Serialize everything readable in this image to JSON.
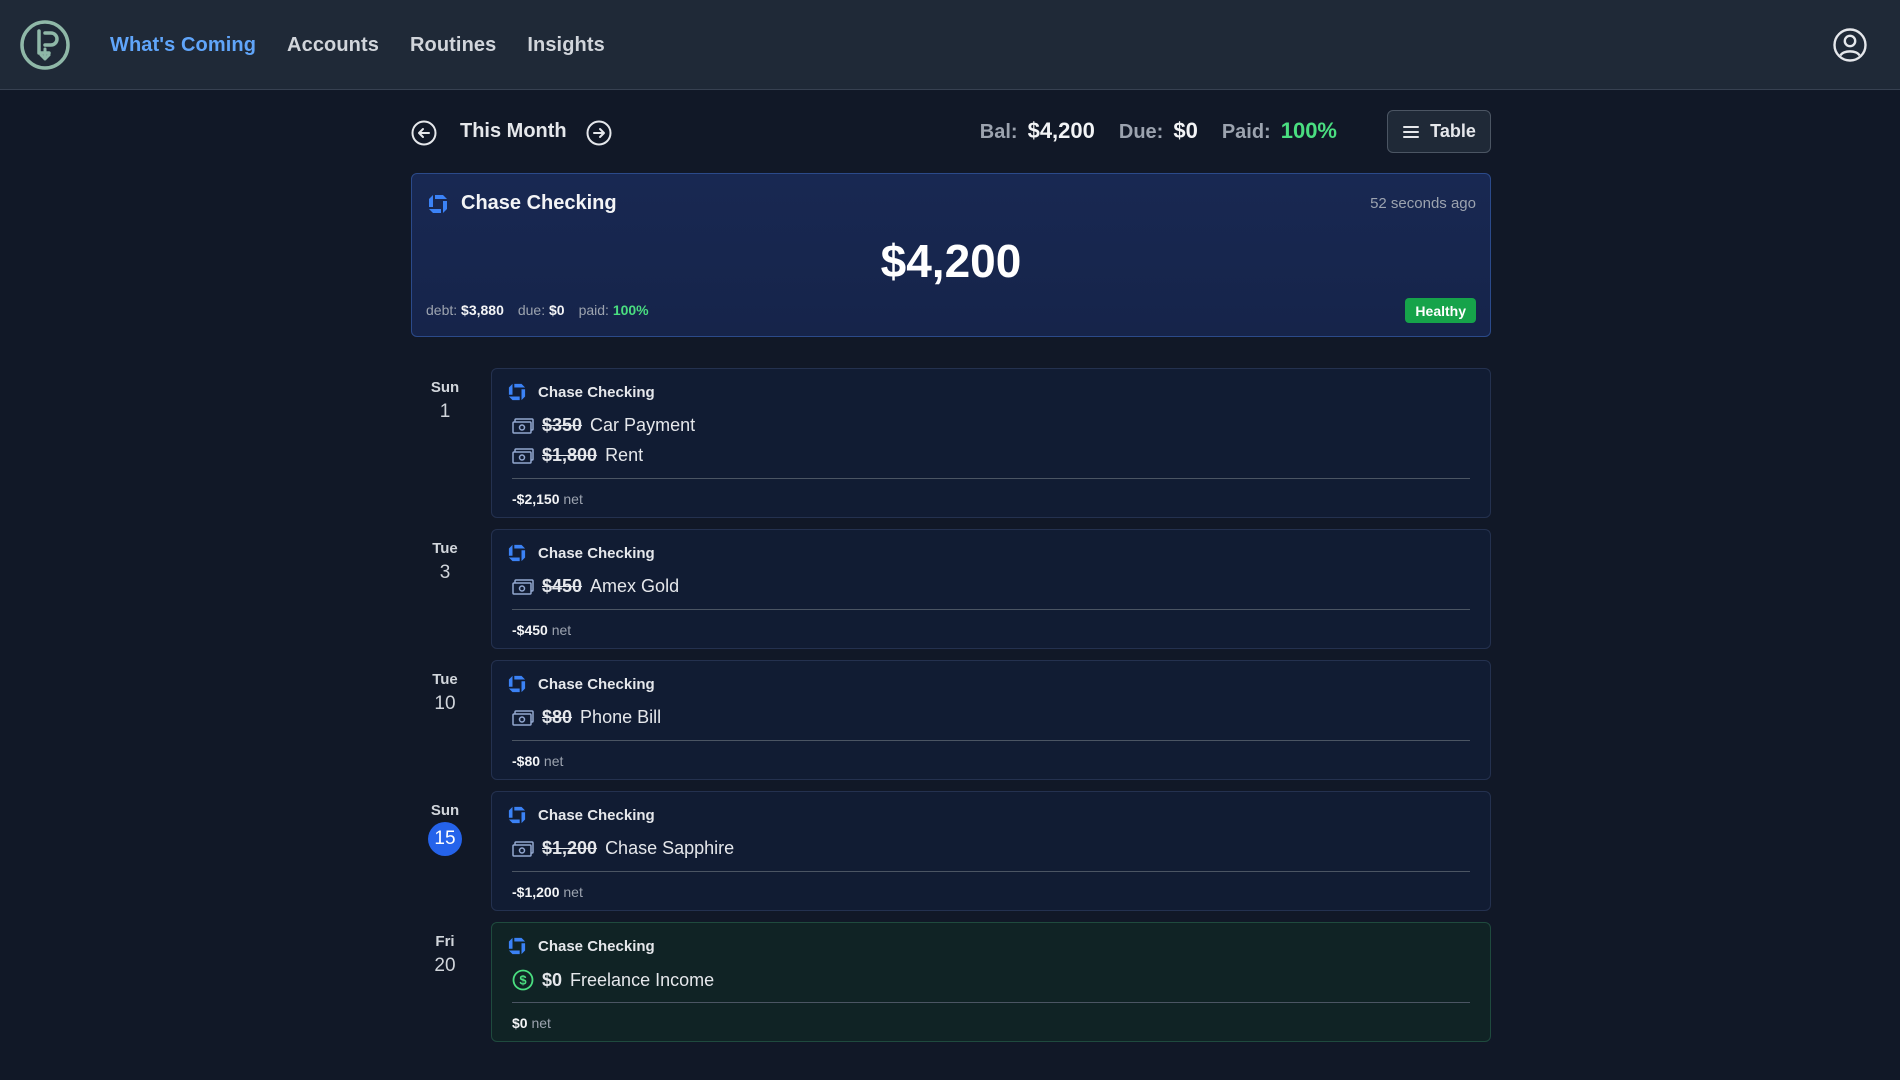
{
  "nav": {
    "items": [
      {
        "label": "What's Coming",
        "active": true
      },
      {
        "label": "Accounts"
      },
      {
        "label": "Routines"
      },
      {
        "label": "Insights"
      }
    ]
  },
  "month": {
    "title": "This Month",
    "bal_label": "Bal:",
    "bal_value": "$4,200",
    "due_label": "Due:",
    "due_value": "$0",
    "paid_label": "Paid:",
    "paid_value": "100%",
    "table_label": "Table"
  },
  "account": {
    "name": "Chase Checking",
    "updated": "52 seconds ago",
    "balance": "$4,200",
    "debt_label": "debt:",
    "debt_value": "$3,880",
    "due_label": "due:",
    "due_value": "$0",
    "paid_label": "paid:",
    "paid_value": "100%",
    "status": "Healthy"
  },
  "days": [
    {
      "dow": "Sun",
      "day": "1",
      "account": "Chase Checking",
      "items": [
        {
          "amount": "$350",
          "name": "Car Payment",
          "icon": "cash-icon"
        },
        {
          "amount": "$1,800",
          "name": "Rent",
          "icon": "cash-icon"
        }
      ],
      "net": "-$2,150",
      "net_label": "net"
    },
    {
      "dow": "Tue",
      "day": "3",
      "account": "Chase Checking",
      "items": [
        {
          "amount": "$450",
          "name": "Amex Gold",
          "icon": "cash-icon"
        }
      ],
      "net": "-$450",
      "net_label": "net"
    },
    {
      "dow": "Tue",
      "day": "10",
      "account": "Chase Checking",
      "items": [
        {
          "amount": "$80",
          "name": "Phone Bill",
          "icon": "cash-icon"
        }
      ],
      "net": "-$80",
      "net_label": "net"
    },
    {
      "dow": "Sun",
      "day": "15",
      "today": true,
      "account": "Chase Checking",
      "items": [
        {
          "amount": "$1,200",
          "name": "Chase Sapphire",
          "icon": "cash-icon"
        }
      ],
      "net": "-$1,200",
      "net_label": "net"
    },
    {
      "dow": "Fri",
      "day": "20",
      "account": "Chase Checking",
      "items": [
        {
          "amount": "$0",
          "name": "Freelance Income",
          "icon": "dollar-circle-icon"
        }
      ],
      "net": "$0",
      "net_label": "net"
    }
  ],
  "colors": {
    "accent": "#60a5fa",
    "success": "#16a34a",
    "today": "#2563eb",
    "background": "#111827"
  }
}
